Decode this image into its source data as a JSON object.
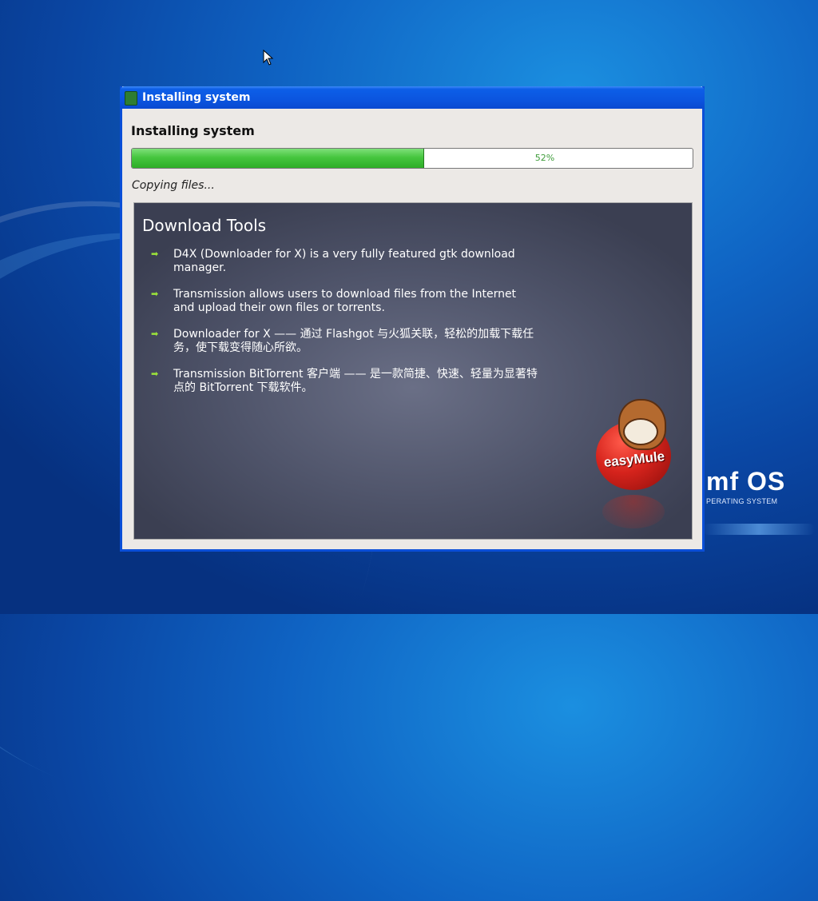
{
  "window": {
    "title": "Installing system",
    "heading": "Installing system",
    "progress": {
      "percent": 52,
      "label": "52%"
    },
    "status": "Copying files..."
  },
  "slide": {
    "title": "Download Tools",
    "items": [
      {
        "text": "D4X (Downloader for X) is a very fully featured gtk download manager."
      },
      {
        "text": "Transmission allows users to download files from the Internet and upload their own files or torrents."
      },
      {
        "text": "Downloader for X —— 通过 Flashgot 与火狐关联，轻松的加载下载任务，使下载变得随心所欲。"
      },
      {
        "text": "Transmission BitTorrent 客户端 —— 是一款简捷、快速、轻量为显著特点的 BitTorrent 下载软件。"
      }
    ],
    "logo_text": "easyMule"
  },
  "desktop": {
    "brand_name": "mf OS",
    "brand_sub": "PERATING SYSTEM"
  },
  "colors": {
    "titlebar": "#0b55df",
    "progress_fill": "#46c63f",
    "bullet": "#9be33a",
    "slide_bg": "#4f546a"
  }
}
